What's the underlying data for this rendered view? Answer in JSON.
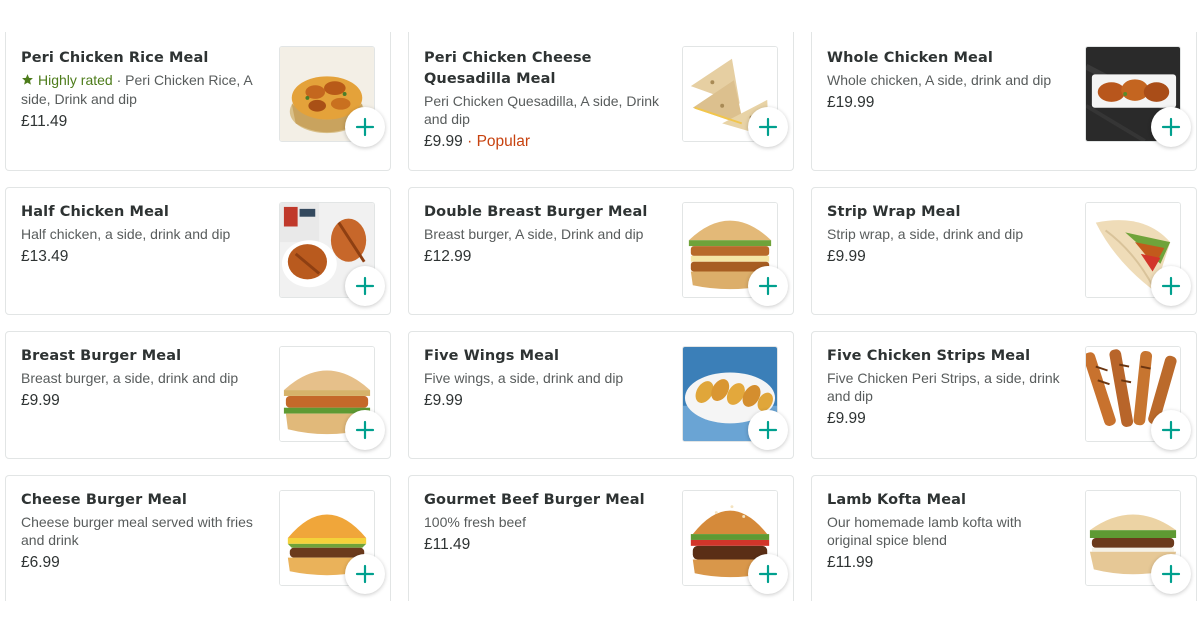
{
  "accent_color": "#00ccbc",
  "items": [
    {
      "title": "Peri Chicken Rice Meal",
      "badge": "Highly rated",
      "badge_sep": " · ",
      "description": "Peri Chicken Rice, A side, Drink and dip",
      "price": "£11.49",
      "tag": "",
      "image_icon": "peri-chicken-rice-photo"
    },
    {
      "title": "Peri Chicken Cheese Quesadilla Meal",
      "badge": "",
      "badge_sep": "",
      "description": "Peri Chicken Quesadilla, A side, Drink and dip",
      "price": "£9.99",
      "tag": "Popular",
      "image_icon": "quesadilla-photo"
    },
    {
      "title": "Whole Chicken Meal",
      "badge": "",
      "badge_sep": "",
      "description": "Whole chicken, A side, drink and dip",
      "price": "£19.99",
      "tag": "",
      "image_icon": "whole-chicken-photo"
    },
    {
      "title": "Half Chicken Meal",
      "badge": "",
      "badge_sep": "",
      "description": "Half chicken, a side, drink and dip",
      "price": "£13.49",
      "tag": "",
      "image_icon": "half-chicken-photo"
    },
    {
      "title": "Double Breast Burger Meal",
      "badge": "",
      "badge_sep": "",
      "description": "Breast burger, A side, Drink and dip",
      "price": "£12.99",
      "tag": "",
      "image_icon": "double-burger-photo"
    },
    {
      "title": "Strip Wrap Meal",
      "badge": "",
      "badge_sep": "",
      "description": "Strip wrap, a side, drink and dip",
      "price": "£9.99",
      "tag": "",
      "image_icon": "wrap-photo"
    },
    {
      "title": "Breast Burger Meal",
      "badge": "",
      "badge_sep": "",
      "description": "Breast burger, a side, drink and dip",
      "price": "£9.99",
      "tag": "",
      "image_icon": "breast-burger-photo"
    },
    {
      "title": "Five Wings Meal",
      "badge": "",
      "badge_sep": "",
      "description": "Five wings, a side, drink and dip",
      "price": "£9.99",
      "tag": "",
      "image_icon": "wings-photo"
    },
    {
      "title": "Five Chicken Strips Meal",
      "badge": "",
      "badge_sep": "",
      "description": "Five Chicken Peri Strips, a side, drink and dip",
      "price": "£9.99",
      "tag": "",
      "image_icon": "strips-photo"
    },
    {
      "title": "Cheese Burger Meal",
      "badge": "",
      "badge_sep": "",
      "description": "Cheese burger meal served with fries and drink",
      "price": "£6.99",
      "tag": "",
      "image_icon": "cheese-burger-photo"
    },
    {
      "title": "Gourmet Beef Burger Meal",
      "badge": "",
      "badge_sep": "",
      "description": "100% fresh beef",
      "price": "£11.49",
      "tag": "",
      "image_icon": "beef-burger-photo"
    },
    {
      "title": "Lamb Kofta Meal",
      "badge": "",
      "badge_sep": "",
      "description": "Our homemade lamb kofta with original spice blend",
      "price": "£11.99",
      "tag": "",
      "image_icon": "kofta-photo"
    }
  ]
}
